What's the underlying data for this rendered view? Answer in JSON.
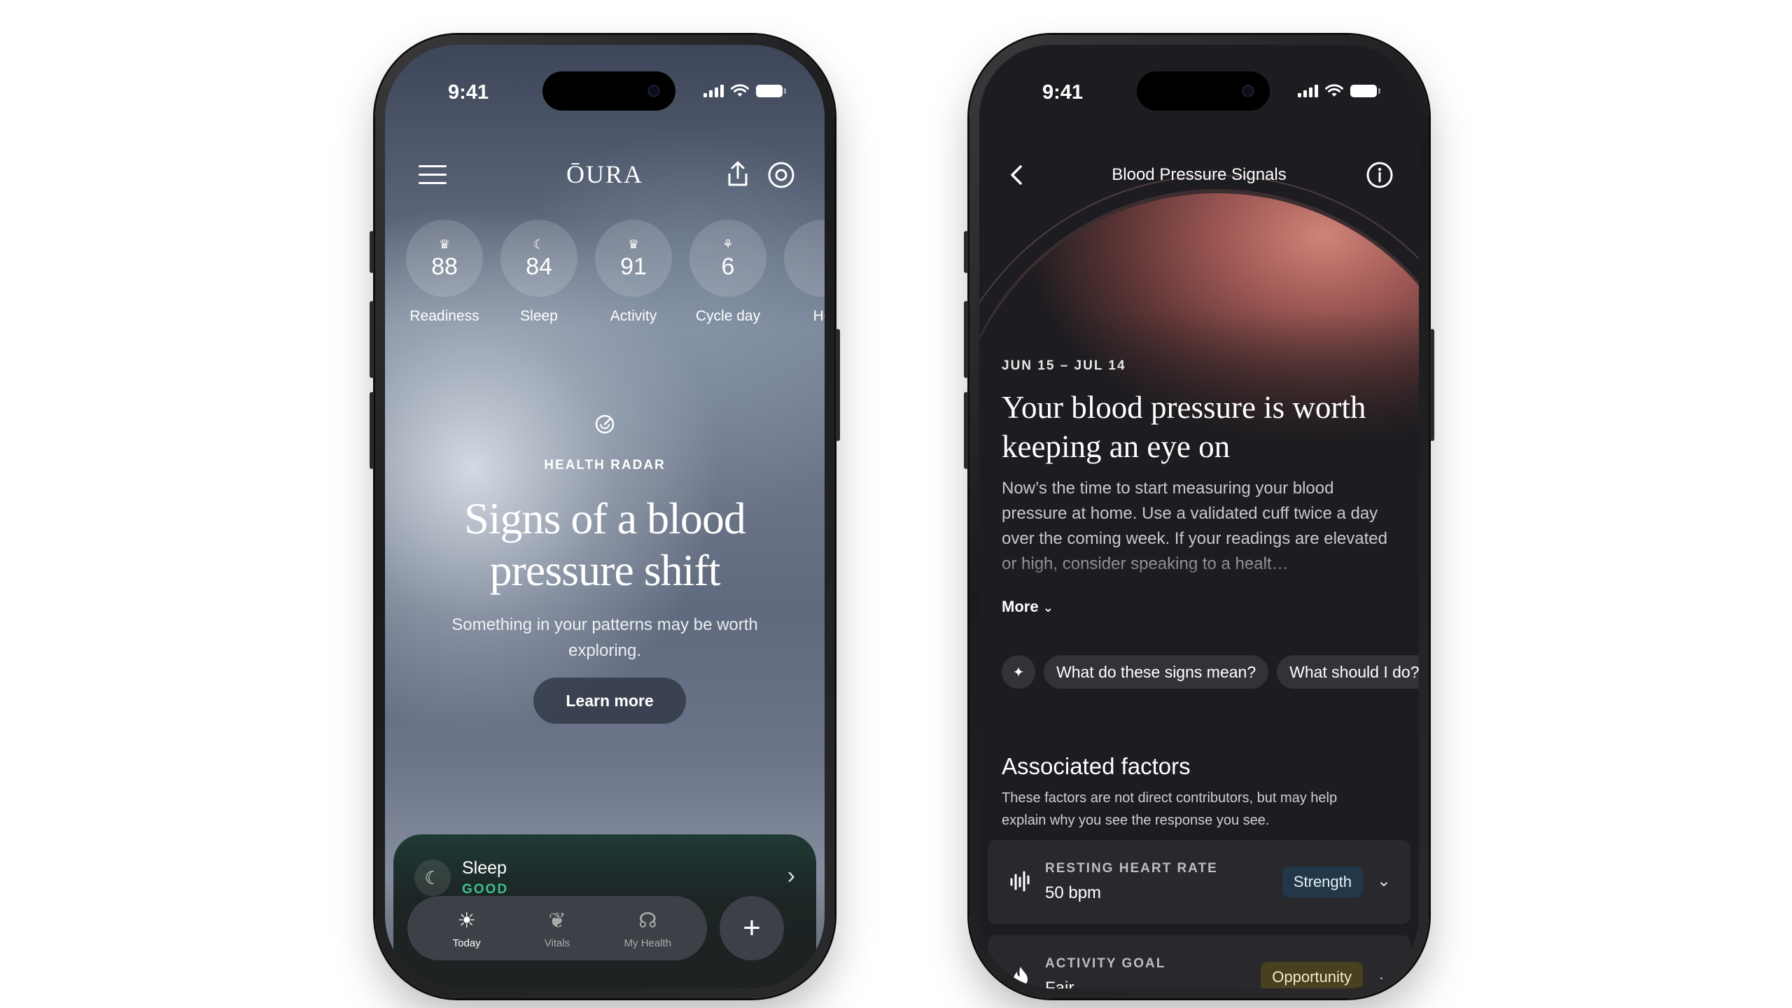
{
  "left_phone": {
    "status": {
      "time": "9:41"
    },
    "header": {
      "brand": "ŌURA"
    },
    "scores": [
      {
        "icon": "crown-icon",
        "glyph": "♛",
        "value": "88",
        "label": "Readiness"
      },
      {
        "icon": "moon-icon",
        "glyph": "☾",
        "value": "84",
        "label": "Sleep"
      },
      {
        "icon": "crown-icon",
        "glyph": "♛",
        "value": "91",
        "label": "Activity"
      },
      {
        "icon": "sprout-icon",
        "glyph": "⚘",
        "value": "6",
        "label": "Cycle day"
      },
      {
        "icon": "heart-icon",
        "glyph": "",
        "value": "",
        "label": "He"
      }
    ],
    "radar": {
      "label": "HEALTH RADAR",
      "title": "Signs of a blood pressure shift",
      "subtitle": "Something in your patterns may be worth exploring.",
      "button": "Learn more"
    },
    "sleep_card": {
      "title": "Sleep",
      "status": "GOOD"
    },
    "tabs": [
      {
        "label": "Today",
        "icon": "sun-icon",
        "glyph": "☀",
        "active": true
      },
      {
        "label": "Vitals",
        "icon": "leaf-icon",
        "glyph": "❦",
        "active": false
      },
      {
        "label": "My Health",
        "icon": "head-icon",
        "glyph": "☊",
        "active": false
      }
    ],
    "fab": "+"
  },
  "right_phone": {
    "status": {
      "time": "9:41"
    },
    "header": {
      "title": "Blood Pressure Signals"
    },
    "date_range": "JUN 15 – JUL 14",
    "headline": "Your blood pressure is worth keeping an eye on",
    "body": "Now’s the time to start measuring your blood pressure at home. Use a validated cuff twice a day over the coming week. If your readings are elevated or high, consider speaking to a healt…",
    "more": "More",
    "chips": [
      "What do these signs mean?",
      "What should I do?"
    ],
    "associated": {
      "title": "Associated factors",
      "description": "These factors are not direct contributors, but may help explain why you see the response you see."
    },
    "factors": [
      {
        "icon": "heart-rate-icon",
        "label": "RESTING HEART RATE",
        "value": "50 bpm",
        "badge": "Strength"
      },
      {
        "icon": "flame-icon",
        "label": "ACTIVITY GOAL",
        "value": "Fair",
        "badge": "Opportunity"
      }
    ]
  },
  "colors": {
    "sleep_good": "#3fbf8e",
    "strength_badge": "#223848",
    "opportunity_badge": "#48401e",
    "orb_accent": "#d08478"
  }
}
